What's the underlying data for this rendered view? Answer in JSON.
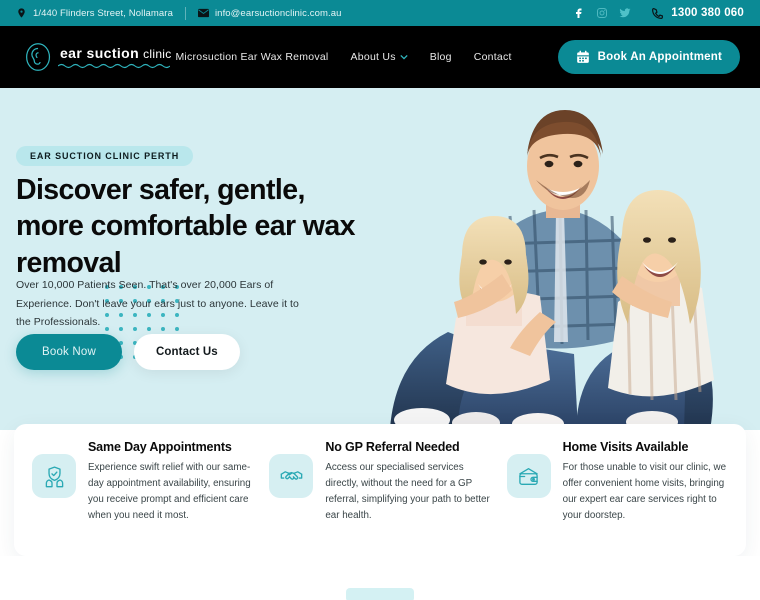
{
  "topbar": {
    "address": "1/440 Flinders Street, Nollamara",
    "address_icon": "map-pin-icon",
    "email": "info@earsuctionclinic.com.au",
    "email_icon": "envelope-icon",
    "socials": [
      {
        "name": "facebook-icon",
        "glyph": "f"
      },
      {
        "name": "instagram-icon",
        "glyph": "ig"
      },
      {
        "name": "twitter-icon",
        "glyph": "tw"
      }
    ],
    "phone": "1300 380 060",
    "phone_icon": "phone-icon",
    "bg_color": "#0b8a95"
  },
  "header": {
    "logo": {
      "icon": "ear-outline-icon",
      "name_bold": "ear suction",
      "name_light": "clinic"
    },
    "nav": [
      {
        "label": "Microsuction Ear Wax Removal",
        "has_dropdown": false
      },
      {
        "label": "About Us",
        "has_dropdown": true
      },
      {
        "label": "Blog",
        "has_dropdown": false
      },
      {
        "label": "Contact",
        "has_dropdown": false
      }
    ],
    "cta": {
      "label": "Book An Appointment",
      "icon": "calendar-icon"
    },
    "bg_color": "#000000"
  },
  "hero": {
    "badge": "EAR SUCTION CLINIC PERTH",
    "headline": "Discover safer, gentle, more comfortable ear wax removal",
    "subtext": "Over 10,000 Patients Seen. That's over 20,000 Ears of Experience. Don't leave your ears just to anyone. Leave it to the Professionals.",
    "primary_button": "Book Now",
    "secondary_button": "Contact Us",
    "bg_color": "#d5eef2",
    "accent_color": "#0b8a95",
    "image_alt": "family-photo"
  },
  "features": [
    {
      "icon": "shield-in-hands-icon",
      "title": "Same Day Appointments",
      "desc": "Experience swift relief with our same-day appointment availability, ensuring you receive prompt and efficient care when you need it most."
    },
    {
      "icon": "handshake-icon",
      "title": "No GP Referral Needed",
      "desc": "Access our specialised services directly, without the need for a GP referral, simplifying your path to better ear health."
    },
    {
      "icon": "wallet-icon",
      "title": "Home Visits Available",
      "desc": "For those unable to visit our clinic, we offer convenient home visits, bringing our expert ear care services right to your doorstep."
    }
  ]
}
